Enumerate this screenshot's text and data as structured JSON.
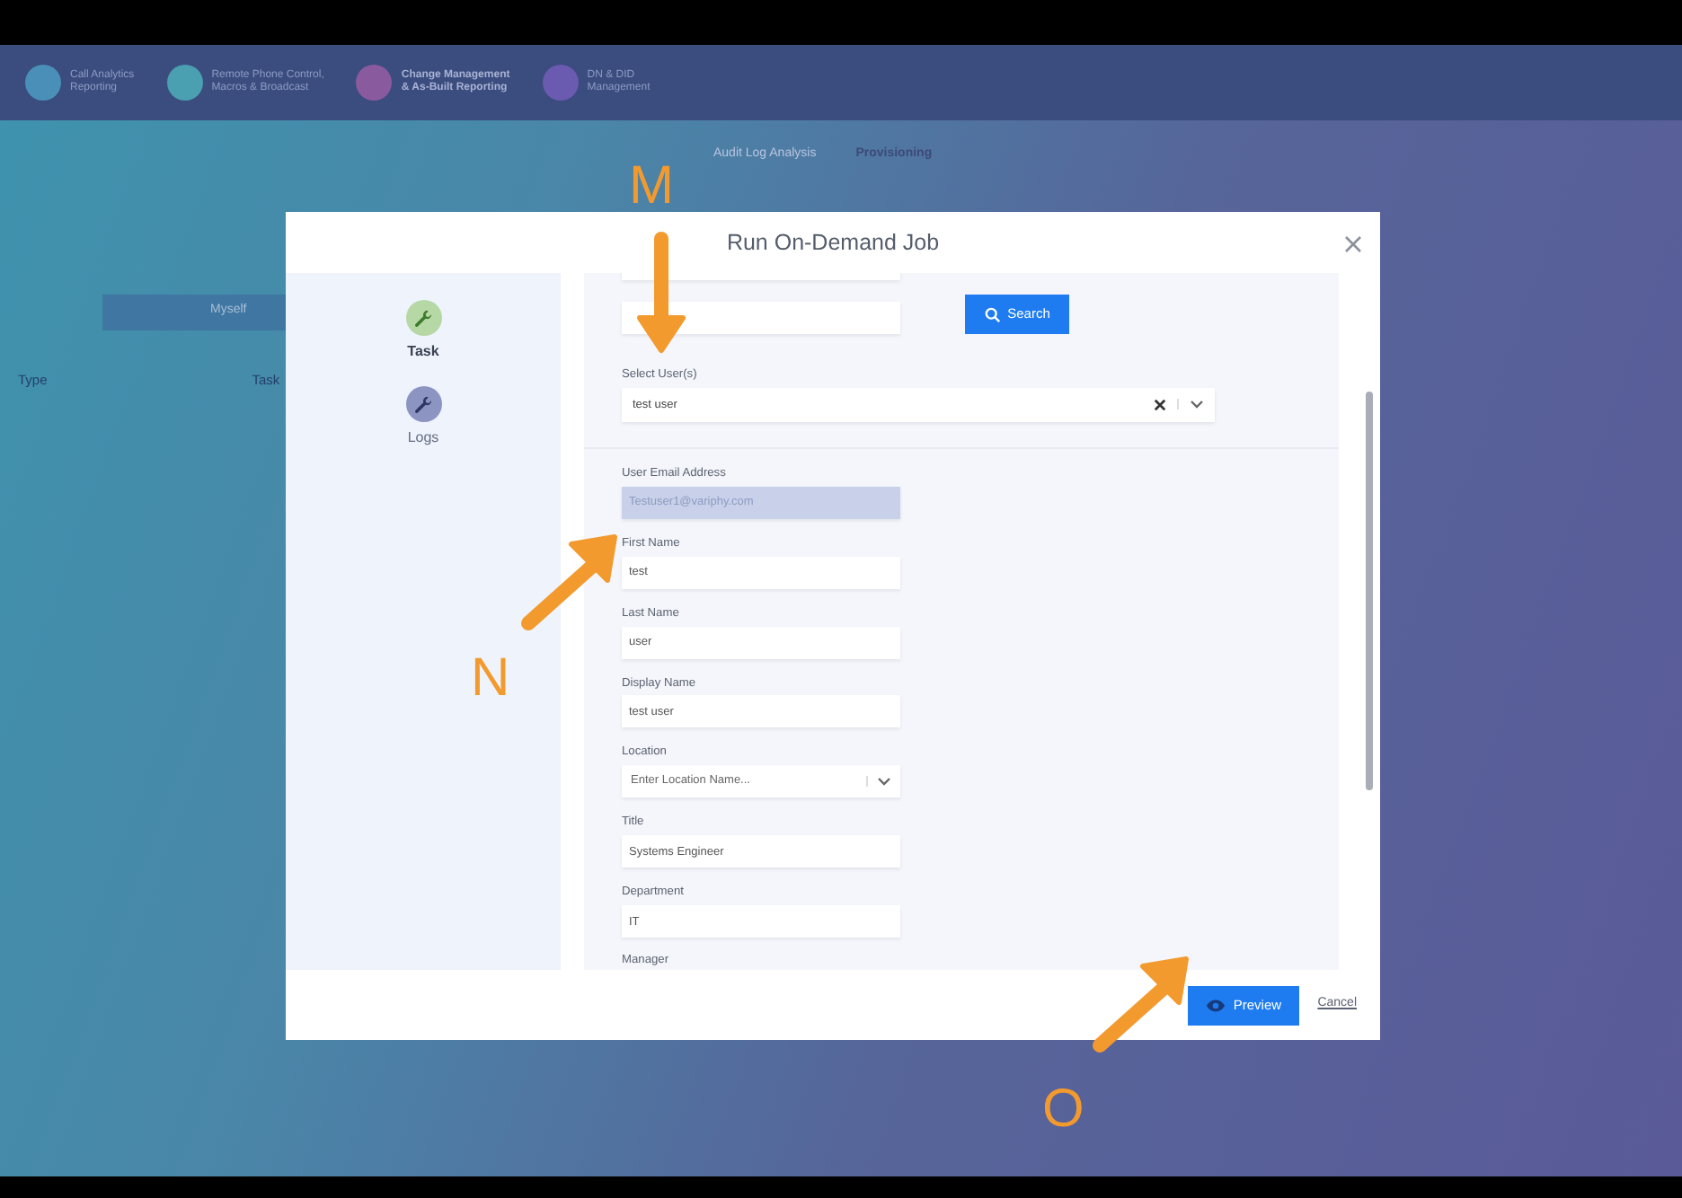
{
  "background_app": {
    "nav": [
      {
        "label": "Call Analytics\nReporting",
        "color": "#4a8fb8",
        "selected": false
      },
      {
        "label": "Remote Phone Control,\nMacros & Broadcast",
        "color": "#4a9fb0",
        "selected": false
      },
      {
        "label": "Change Management\n& As-Built Reporting",
        "color": "#8a5a9e",
        "selected": true
      },
      {
        "label": "DN & DID\nManagement",
        "color": "#6a5ab0",
        "selected": false
      }
    ],
    "tabs": [
      {
        "label": "Audit Log Analysis",
        "selected": false
      },
      {
        "label": "Provisioning",
        "selected": true
      }
    ],
    "myself_button": "Myself",
    "table_columns": [
      "Type",
      "Task"
    ]
  },
  "dialog": {
    "title": "Run On-Demand Job",
    "sidebar": [
      {
        "label": "Task",
        "selected": true,
        "color": "#b5d8a4"
      },
      {
        "label": "Logs",
        "selected": false,
        "color": "#8c95c2"
      }
    ],
    "search_button": "Search",
    "fields": [
      {
        "kind": "multiselect",
        "label": "Select User(s)",
        "value": "test user"
      },
      {
        "kind": "text",
        "label": "User Email Address",
        "value": "Testuser1@variphy.com",
        "disabled": true
      },
      {
        "kind": "text",
        "label": "First Name",
        "value": "test",
        "disabled": false
      },
      {
        "kind": "text",
        "label": "Last Name",
        "value": "user",
        "disabled": false
      },
      {
        "kind": "text",
        "label": "Display Name",
        "value": "test user",
        "disabled": false
      },
      {
        "kind": "select",
        "label": "Location",
        "placeholder": "Enter Location Name..."
      },
      {
        "kind": "text",
        "label": "Title",
        "value": "Systems Engineer",
        "disabled": false
      },
      {
        "kind": "text",
        "label": "Department",
        "value": "IT",
        "disabled": false
      },
      {
        "kind": "label",
        "label": "Manager"
      }
    ],
    "preview_button": "Preview",
    "cancel_link": "Cancel"
  },
  "annotations": [
    {
      "letter": "M"
    },
    {
      "letter": "N"
    },
    {
      "letter": "O"
    }
  ]
}
